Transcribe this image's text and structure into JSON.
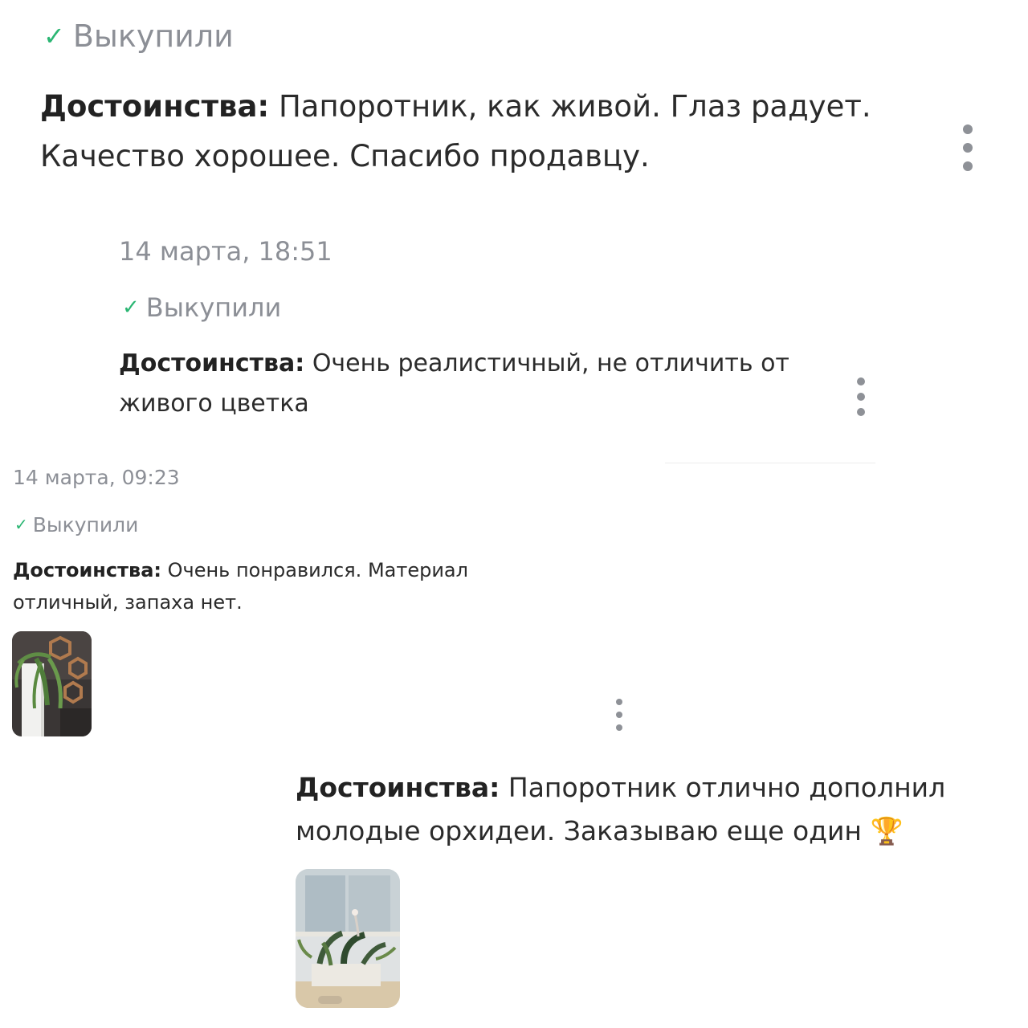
{
  "reviews": [
    {
      "status": "Выкупили",
      "label": "Достоинства:",
      "text": "Папоротник, как живой. Глаз радует. Качество хорошее. Спасибо продавцу."
    },
    {
      "date": "14 марта, 18:51",
      "status": "Выкупили",
      "label": "Достоинства:",
      "text": "Очень реалистичный, не отличить от живого цветка"
    },
    {
      "date": "14 марта, 09:23",
      "status": "Выкупили",
      "label": "Достоинства:",
      "text": "Очень понравился. Материал отличный, запаха нет."
    },
    {
      "label": "Достоинства:",
      "text": "Папоротник отлично дополнил молодые орхидеи. Заказываю еще один",
      "emoji": "🏆"
    }
  ],
  "icons": {
    "check": "check-icon",
    "menu": "more-vertical-icon",
    "trophy": "trophy-emoji"
  },
  "colors": {
    "accent_check": "#2bb673",
    "muted_text": "#8c8f96",
    "body_text": "#2b2b2b",
    "menu_dots": "#8e9197"
  }
}
